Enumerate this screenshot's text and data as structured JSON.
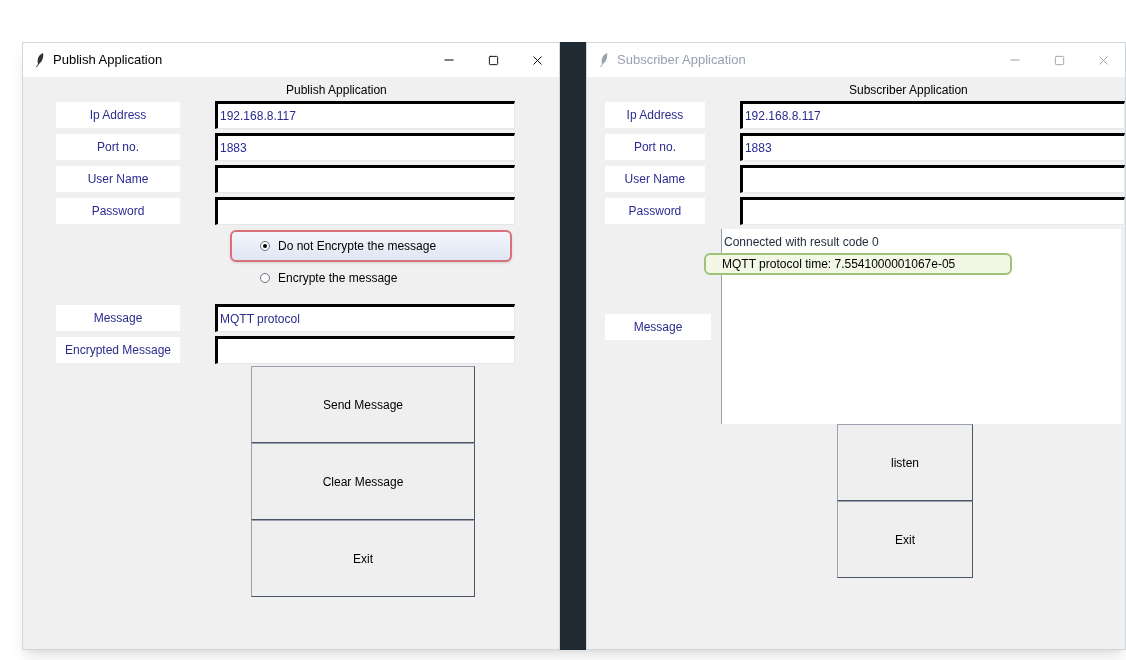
{
  "windows": [
    {
      "kind": "publisher",
      "title": "Publish Application",
      "active": true,
      "heading": "Publish Application",
      "fields": [
        {
          "label": "Ip Address",
          "value": "192.168.8.117"
        },
        {
          "label": "Port no.",
          "value": "1883"
        },
        {
          "label": "User Name"
        },
        {
          "label": "Password"
        }
      ],
      "options": [
        {
          "label": "Do not Encrypte  the message",
          "selected": true,
          "highlighted": true
        },
        {
          "label": "Encrypte the message",
          "selected": false,
          "highlighted": false
        }
      ],
      "message_fields": [
        {
          "label": "Message",
          "value": "MQTT protocol"
        },
        {
          "label": "Encrypted Message"
        }
      ],
      "buttons": [
        "Send Message",
        "Clear Message",
        "Exit"
      ]
    },
    {
      "kind": "subscriber",
      "title": "Subscriber Application",
      "active": false,
      "heading": "Subscriber Application",
      "fields": [
        {
          "label": "Ip Address",
          "value": "192.168.8.117"
        },
        {
          "label": "Port no.",
          "value": "1883"
        },
        {
          "label": "User Name"
        },
        {
          "label": "Password"
        }
      ],
      "log_label": "Message",
      "log": [
        {
          "text": "Connected with result code 0",
          "highlighted": false
        },
        {
          "text": "MQTT protocol time: 7.5541000001067e-05",
          "highlighted": true
        }
      ],
      "buttons": [
        "listen",
        "Exit"
      ]
    }
  ]
}
